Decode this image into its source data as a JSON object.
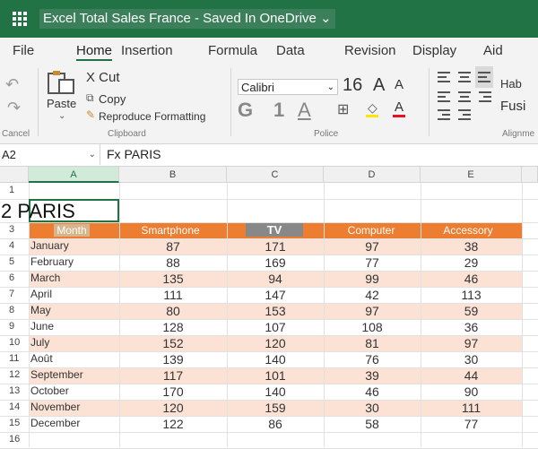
{
  "titlebar": {
    "title": "Excel Total Sales France - Saved In OneDrive ⌄",
    "waffle_icon": "app-launcher-icon",
    "color": "#217346"
  },
  "tabs": [
    "File",
    "Home",
    "Insertion",
    "Formula",
    "Data",
    "Revision",
    "Display",
    "Aid"
  ],
  "active_tab": "Home",
  "ribbon": {
    "undo_label": "↶",
    "redo_label": "↷",
    "paste_label": "Paste",
    "cut_label": "X Cut",
    "copy_label": "Copy",
    "format_painter_label": "Reproduce Formatting",
    "clipboard_group": "Clipboard",
    "cancel_group": "Cancel",
    "font_name": "Calibri",
    "font_size": "16",
    "font_group": "Police",
    "bold_label": "G",
    "italic_label": "1",
    "underline_label": "A",
    "grow_font": "A",
    "shrink_font": "A",
    "wrap_label": "Hab",
    "merge_label": "Fusi",
    "alignment_group": "Alignme",
    "fill_color": "#ffe600",
    "font_color": "#e81123"
  },
  "formula_bar": {
    "cell_ref": "A2",
    "formula": "Fx PARIS"
  },
  "columns": [
    "A",
    "B",
    "C",
    "D",
    "E"
  ],
  "selected_column": "A",
  "rows": [
    "1",
    "2",
    "3",
    "4",
    "5",
    "6",
    "7",
    "8",
    "9",
    "10",
    "11",
    "12",
    "13",
    "14",
    "15",
    "16"
  ],
  "cells": {
    "a2": "2 PARIS",
    "headers": [
      "Month",
      "Smartphone",
      "TV",
      "Computer",
      "Accessory"
    ],
    "data": [
      [
        "January",
        "87",
        "171",
        "97",
        "38"
      ],
      [
        "February",
        "88",
        "169",
        "77",
        "29"
      ],
      [
        "March",
        "135",
        "94",
        "99",
        "46"
      ],
      [
        "April",
        "111",
        "147",
        "42",
        "113"
      ],
      [
        "May",
        "80",
        "153",
        "97",
        "59"
      ],
      [
        "June",
        "128",
        "107",
        "108",
        "36"
      ],
      [
        "July",
        "152",
        "120",
        "81",
        "97"
      ],
      [
        "Août",
        "139",
        "140",
        "76",
        "30"
      ],
      [
        "September",
        "117",
        "101",
        "39",
        "44"
      ],
      [
        "October",
        "170",
        "140",
        "46",
        "90"
      ],
      [
        "November",
        "120",
        "159",
        "30",
        "111"
      ],
      [
        "December",
        "122",
        "86",
        "58",
        "77"
      ]
    ]
  },
  "theme": {
    "header_fill": "#ed7d31",
    "band_fill": "#fbe2d5",
    "accent": "#217346"
  }
}
